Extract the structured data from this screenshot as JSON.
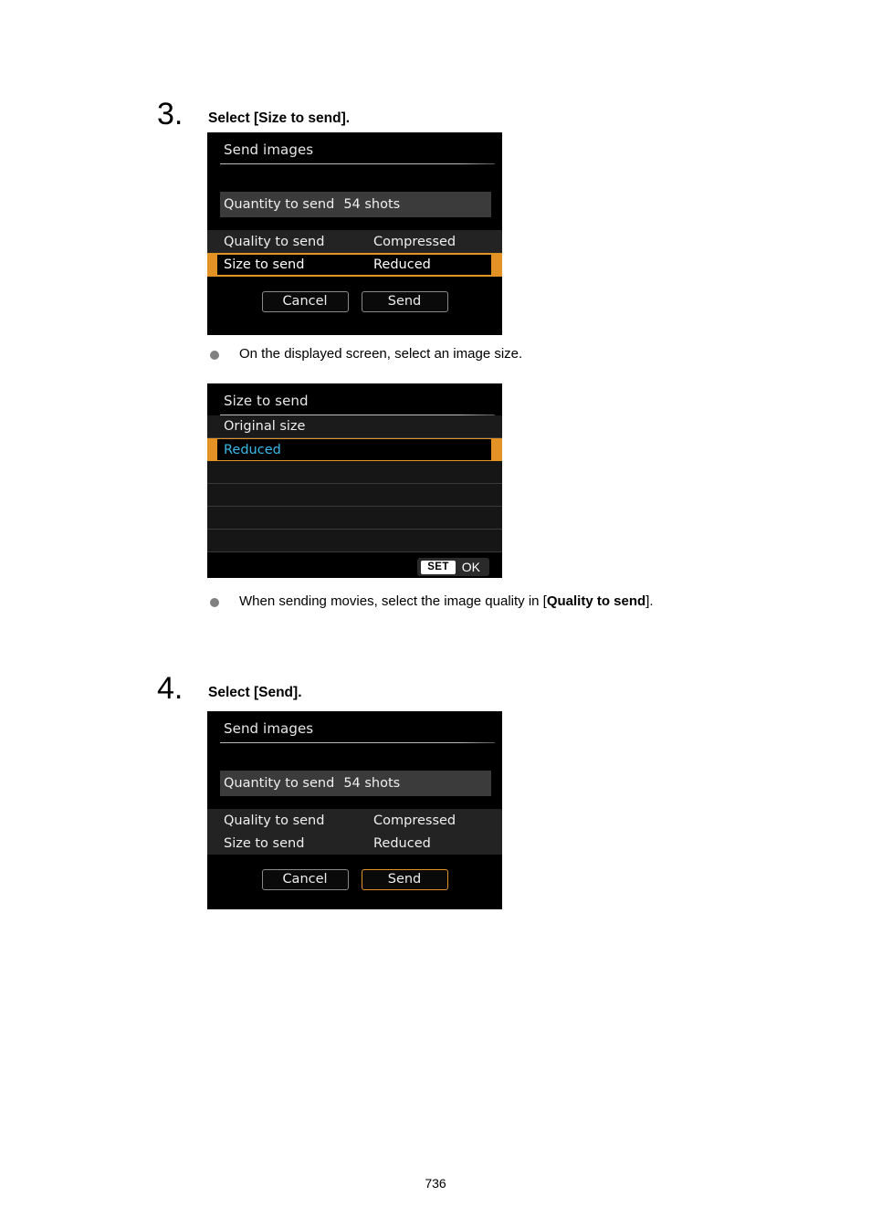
{
  "page": {
    "number": "736"
  },
  "steps": [
    {
      "num": "3.",
      "title": "Select [Size to send]."
    },
    {
      "num": "4.",
      "title": "Select [Send]."
    }
  ],
  "screen1": {
    "title": "Send images",
    "quantity": {
      "label": "Quantity to send",
      "value": "54 shots"
    },
    "rows": [
      {
        "label": "Quality to send",
        "value": "Compressed",
        "highlighted": false
      },
      {
        "label": "Size to send",
        "value": "Reduced",
        "highlighted": true
      }
    ],
    "buttons": [
      {
        "label": "Cancel",
        "active": false
      },
      {
        "label": "Send",
        "active": false
      }
    ]
  },
  "screen2": {
    "title": "Size to send",
    "options": [
      {
        "label": "Original size",
        "selected": false
      },
      {
        "label": "Reduced",
        "selected": true
      },
      {
        "label": "",
        "selected": false
      },
      {
        "label": "",
        "selected": false
      },
      {
        "label": "",
        "selected": false
      },
      {
        "label": "",
        "selected": false
      }
    ],
    "footer": {
      "set_label": "SET",
      "ok_label": "OK"
    }
  },
  "screen3": {
    "title": "Send images",
    "quantity": {
      "label": "Quantity to send",
      "value": "54 shots"
    },
    "rows": [
      {
        "label": "Quality to send",
        "value": "Compressed",
        "highlighted": false
      },
      {
        "label": "Size to send",
        "value": "Reduced",
        "highlighted": false
      }
    ],
    "buttons": [
      {
        "label": "Cancel",
        "active": false
      },
      {
        "label": "Send",
        "active": true
      }
    ]
  },
  "bullets": [
    {
      "text_before": "On the displayed screen, select an image size.",
      "bold": "",
      "text_after": ""
    },
    {
      "text_before": "When sending movies, select the image quality in [",
      "bold": "Quality to send",
      "text_after": "]."
    }
  ],
  "colors": {
    "highlight_orange": "#e39226",
    "selected_text_cyan": "#3bb9e8",
    "bullet_gray": "#808080",
    "lcd_background": "#000000"
  }
}
